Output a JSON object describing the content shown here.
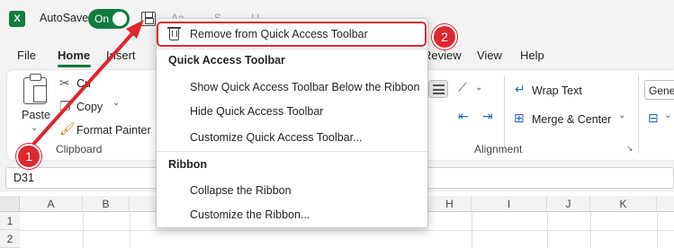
{
  "titlebar": {
    "app_logo": "X",
    "autosave_label": "AutoSave",
    "autosave_state": "On",
    "document_title_partial": "Aa..........S..........l.l..."
  },
  "tabs": [
    {
      "label": "File"
    },
    {
      "label": "Home",
      "active": true
    },
    {
      "label": "Insert"
    },
    {
      "label": "Review"
    },
    {
      "label": "View"
    },
    {
      "label": "Help"
    }
  ],
  "ribbon": {
    "clipboard": {
      "paste_label": "Paste",
      "cut_label": "Cu",
      "copy_label": "Copy",
      "format_painter_label": "Format Painter",
      "group_label": "Clipboard"
    },
    "alignment": {
      "wrap_text_label": "Wrap Text",
      "merge_center_label": "Merge & Center",
      "group_label": "Alignment"
    },
    "number": {
      "format_partial": "Gener"
    }
  },
  "formula_bar": {
    "name_box": "D31"
  },
  "grid": {
    "columns": [
      "A",
      "B",
      "H",
      "I",
      "J",
      "K"
    ],
    "rows": [
      "1",
      "2"
    ]
  },
  "context_menu": {
    "remove_item": "Remove from Quick Access Toolbar",
    "section_qat": "Quick Access Toolbar",
    "qat_items": [
      "Show Quick Access Toolbar Below the Ribbon",
      "Hide Quick Access Toolbar",
      "Customize Quick Access Toolbar..."
    ],
    "section_ribbon": "Ribbon",
    "ribbon_items": [
      "Collapse the Ribbon",
      "Customize the Ribbon..."
    ]
  },
  "callouts": {
    "step1": "1",
    "step2": "2",
    "color": "#e0262e"
  },
  "colors": {
    "accent": "#107c41",
    "highlight": "#e0262e"
  }
}
